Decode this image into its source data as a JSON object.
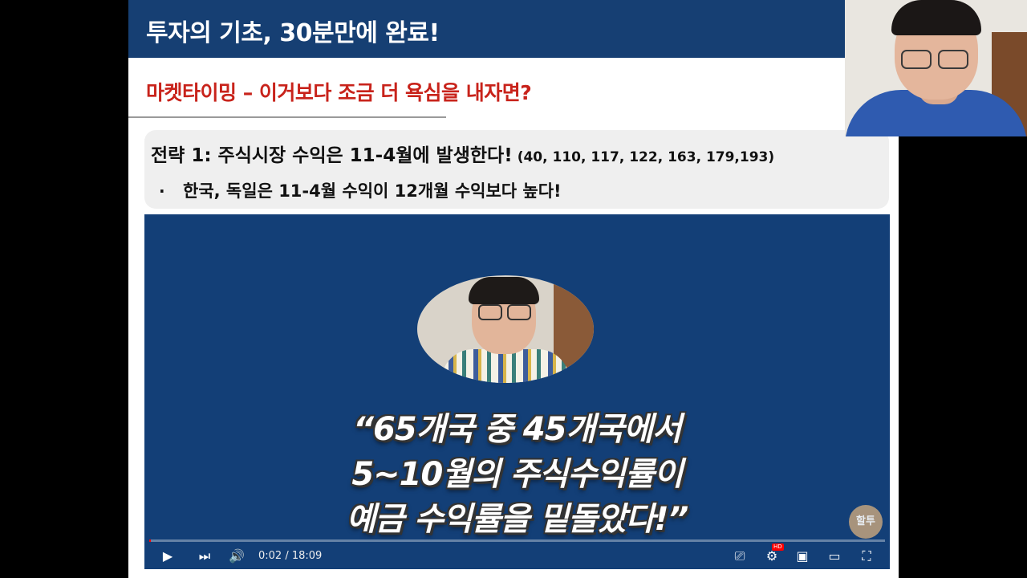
{
  "slide": {
    "title": "투자의 기초, 30분만에 완료!",
    "subtitle": "마켓타이밍 – 이거보다 조금 더 욕심을 내자면?",
    "strategy_heading": "전략 1: 주식시장 수익은 11-4월에 발생한다!",
    "strategy_refs": "(40, 110, 117, 122, 163, 179,193)",
    "bullet_marker": "·",
    "bullet_text": "한국, 독일은 11-4월 수익이 12개월 수익보다 높다!"
  },
  "video": {
    "quote_lines": [
      "“65개국 중 45개국에서",
      "5~10월의 주식수익률이",
      "예금 수익률을 밑돌았다!”"
    ],
    "logo_text": "할투",
    "current_time": "0:02",
    "duration": "18:09",
    "time_display": "0:02 / 18:09",
    "progress_fraction": 0.002,
    "controls": {
      "play_icon": "▶",
      "next_icon": "⏭",
      "volume_icon": "🔊",
      "subtitles_icon": "⎚",
      "settings_icon": "⚙",
      "hd_badge": "HD",
      "miniplayer_icon": "▣",
      "theater_icon": "▭",
      "fullscreen_icon": "⛶"
    }
  },
  "colors": {
    "title_bar": "#163f73",
    "subtitle_red": "#c8231b",
    "video_bg": "#133f77",
    "progress_red": "#ff0000"
  }
}
